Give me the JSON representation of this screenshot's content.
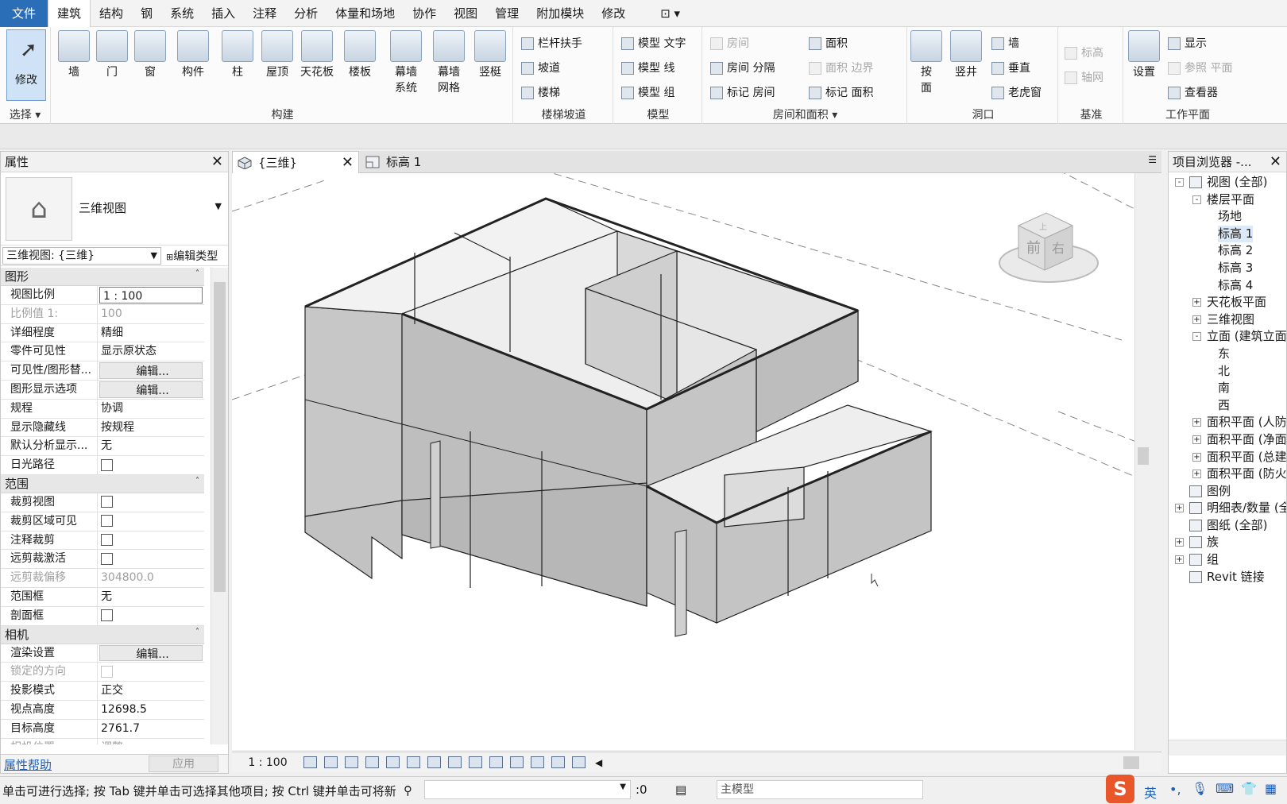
{
  "menu": {
    "items": [
      "文件",
      "建筑",
      "结构",
      "钢",
      "系统",
      "插入",
      "注释",
      "分析",
      "体量和场地",
      "协作",
      "视图",
      "管理",
      "附加模块",
      "修改"
    ],
    "extra_icon": "quick-access-icon"
  },
  "ribbon": {
    "modify": "修改",
    "select_label": "选择",
    "build": {
      "label": "构建",
      "buttons": [
        "墙",
        "门",
        "窗",
        "构件",
        "柱",
        "屋顶",
        "天花板",
        "楼板",
        "幕墙\n系统",
        "幕墙\n网格",
        "竖梃"
      ]
    },
    "stairs": {
      "label": "楼梯坡道",
      "buttons": [
        "栏杆扶手",
        "坡道",
        "楼梯"
      ]
    },
    "model": {
      "label": "模型",
      "buttons": [
        "模型 文字",
        "模型 线",
        "模型 组"
      ]
    },
    "room": {
      "label": "房间和面积",
      "buttons": [
        "房间",
        "房间 分隔",
        "标记 房间",
        "面积",
        "面积 边界",
        "标记 面积"
      ]
    },
    "opening": {
      "label": "洞口",
      "buttons": [
        "按\n面",
        "竖井",
        "墙",
        "垂直",
        "老虎窗"
      ]
    },
    "datum": {
      "label": "基准",
      "buttons": [
        "标高",
        "轴网"
      ]
    },
    "workplane": {
      "label": "工作平面",
      "buttons": [
        "设置",
        "显示",
        "参照 平面",
        "查看器"
      ]
    }
  },
  "properties": {
    "title": "属性",
    "type_name": "三维视图",
    "instance": "三维视图: {三维}",
    "edit_type": "编辑类型",
    "sections": [
      {
        "name": "图形",
        "rows": [
          {
            "k": "视图比例",
            "v": "1 : 100",
            "t": "input"
          },
          {
            "k": "比例值 1:",
            "v": "100",
            "t": "ro"
          },
          {
            "k": "详细程度",
            "v": "精细"
          },
          {
            "k": "零件可见性",
            "v": "显示原状态"
          },
          {
            "k": "可见性/图形替...",
            "v": "编辑...",
            "t": "btn"
          },
          {
            "k": "图形显示选项",
            "v": "编辑...",
            "t": "btn"
          },
          {
            "k": "规程",
            "v": "协调"
          },
          {
            "k": "显示隐藏线",
            "v": "按规程"
          },
          {
            "k": "默认分析显示...",
            "v": "无"
          },
          {
            "k": "日光路径",
            "v": "",
            "t": "chk"
          }
        ]
      },
      {
        "name": "范围",
        "rows": [
          {
            "k": "裁剪视图",
            "v": "",
            "t": "chk"
          },
          {
            "k": "裁剪区域可见",
            "v": "",
            "t": "chk"
          },
          {
            "k": "注释裁剪",
            "v": "",
            "t": "chk"
          },
          {
            "k": "远剪裁激活",
            "v": "",
            "t": "chk"
          },
          {
            "k": "远剪裁偏移",
            "v": "304800.0",
            "t": "ro"
          },
          {
            "k": "范围框",
            "v": "无"
          },
          {
            "k": "剖面框",
            "v": "",
            "t": "chk"
          }
        ]
      },
      {
        "name": "相机",
        "rows": [
          {
            "k": "渲染设置",
            "v": "编辑...",
            "t": "btn"
          },
          {
            "k": "锁定的方向",
            "v": "",
            "t": "rochk"
          },
          {
            "k": "投影模式",
            "v": "正交"
          },
          {
            "k": "视点高度",
            "v": "12698.5"
          },
          {
            "k": "目标高度",
            "v": "2761.7"
          },
          {
            "k": "相机位置",
            "v": "调整",
            "t": "ro"
          }
        ]
      }
    ],
    "help": "属性帮助",
    "apply": "应用"
  },
  "tabs": [
    {
      "label": "{三维}",
      "active": true
    },
    {
      "label": "标高 1",
      "active": false
    }
  ],
  "viewcube": {
    "front": "前",
    "right": "右",
    "top": "上"
  },
  "viewbar": {
    "scale": "1 : 100"
  },
  "browser": {
    "title": "项目浏览器 -...",
    "nodes": [
      {
        "l": "视图 (全部)",
        "d": 0,
        "e": "-",
        "i": true
      },
      {
        "l": "楼层平面",
        "d": 1,
        "e": "-"
      },
      {
        "l": "场地",
        "d": 2
      },
      {
        "l": "标高 1",
        "d": 2,
        "s": true
      },
      {
        "l": "标高 2",
        "d": 2
      },
      {
        "l": "标高 3",
        "d": 2
      },
      {
        "l": "标高 4",
        "d": 2
      },
      {
        "l": "天花板平面",
        "d": 1,
        "e": "+"
      },
      {
        "l": "三维视图",
        "d": 1,
        "e": "+"
      },
      {
        "l": "立面 (建筑立面)",
        "d": 1,
        "e": "-"
      },
      {
        "l": "东",
        "d": 2
      },
      {
        "l": "北",
        "d": 2
      },
      {
        "l": "南",
        "d": 2
      },
      {
        "l": "西",
        "d": 2
      },
      {
        "l": "面积平面 (人防分区面积)",
        "d": 1,
        "e": "+"
      },
      {
        "l": "面积平面 (净面积)",
        "d": 1,
        "e": "+"
      },
      {
        "l": "面积平面 (总建筑面积)",
        "d": 1,
        "e": "+"
      },
      {
        "l": "面积平面 (防火分区面积)",
        "d": 1,
        "e": "+"
      },
      {
        "l": "图例",
        "d": 0,
        "i": true
      },
      {
        "l": "明细表/数量 (全部)",
        "d": 0,
        "e": "+",
        "i": true
      },
      {
        "l": "图纸 (全部)",
        "d": 0,
        "i": true
      },
      {
        "l": "族",
        "d": 0,
        "e": "+",
        "i": true
      },
      {
        "l": "组",
        "d": 0,
        "e": "+",
        "i": true
      },
      {
        "l": "Revit 链接",
        "d": 0,
        "i": true
      }
    ]
  },
  "status": {
    "message": "单击可进行选择; 按 Tab 键并单击可选择其他项目; 按 Ctrl 键并单击可将新",
    "filter_count": ":0",
    "model": "主模型",
    "ime": "英"
  }
}
